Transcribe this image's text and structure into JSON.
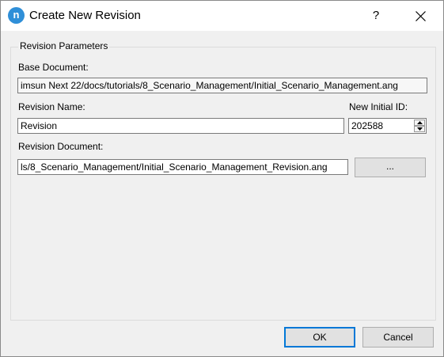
{
  "window": {
    "title": "Create New Revision",
    "app_icon_letter": "n",
    "help_glyph": "?"
  },
  "group": {
    "title": "Revision Parameters"
  },
  "base_document": {
    "label": "Base Document:",
    "value": "imsun Next 22/docs/tutorials/8_Scenario_Management/Initial_Scenario_Management.ang"
  },
  "revision_name": {
    "label": "Revision Name:",
    "value": "Revision"
  },
  "initial_id": {
    "label": "New Initial ID:",
    "value": "202588"
  },
  "revision_document": {
    "label": "Revision Document:",
    "value": "ls/8_Scenario_Management/Initial_Scenario_Management_Revision.ang",
    "browse_label": "..."
  },
  "buttons": {
    "ok": "OK",
    "cancel": "Cancel"
  },
  "colors": {
    "app_icon": "#2f8fd8",
    "default_button_border": "#0078d7"
  }
}
